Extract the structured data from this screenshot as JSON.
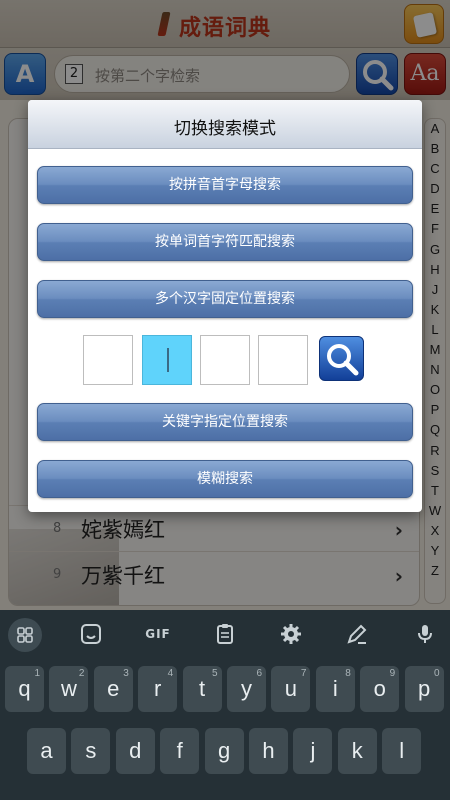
{
  "header": {
    "title": "成语词典"
  },
  "search": {
    "digit": "2",
    "placeholder": "按第二个字检索",
    "aa_label": "Aa"
  },
  "list": [
    {
      "num": "8",
      "text": "姹紫嫣红"
    },
    {
      "num": "9",
      "text": "万紫千红"
    }
  ],
  "alphabet": [
    "A",
    "B",
    "C",
    "D",
    "E",
    "F",
    "G",
    "H",
    "J",
    "K",
    "L",
    "M",
    "N",
    "O",
    "P",
    "Q",
    "R",
    "S",
    "T",
    "W",
    "X",
    "Y",
    "Z"
  ],
  "dialog": {
    "title": "切换搜索模式",
    "buttons": [
      "按拼音首字母搜索",
      "按单词首字符匹配搜索",
      "多个汉字固定位置搜索",
      "关键字指定位置搜索",
      "模糊搜索"
    ],
    "char_boxes": [
      "",
      "",
      "",
      ""
    ],
    "active_box": 2
  },
  "keyboard": {
    "toolbar_icons": [
      "apps-grid-icon",
      "sticker-icon",
      "gif-icon",
      "clipboard-icon",
      "settings-icon",
      "edit-pen-icon",
      "microphone-icon"
    ],
    "gif_label": "GIF",
    "row1": [
      {
        "k": "q",
        "h": "1"
      },
      {
        "k": "w",
        "h": "2"
      },
      {
        "k": "e",
        "h": "3"
      },
      {
        "k": "r",
        "h": "4"
      },
      {
        "k": "t",
        "h": "5"
      },
      {
        "k": "y",
        "h": "6"
      },
      {
        "k": "u",
        "h": "7"
      },
      {
        "k": "i",
        "h": "8"
      },
      {
        "k": "o",
        "h": "9"
      },
      {
        "k": "p",
        "h": "0"
      }
    ],
    "row2": [
      "a",
      "s",
      "d",
      "f",
      "g",
      "h",
      "j",
      "k",
      "l"
    ]
  },
  "colors": {
    "accent": "#5b7fb4",
    "title_red": "#b8341b",
    "active_box": "#5fd3fb",
    "keyboard_bg": "#253036"
  }
}
